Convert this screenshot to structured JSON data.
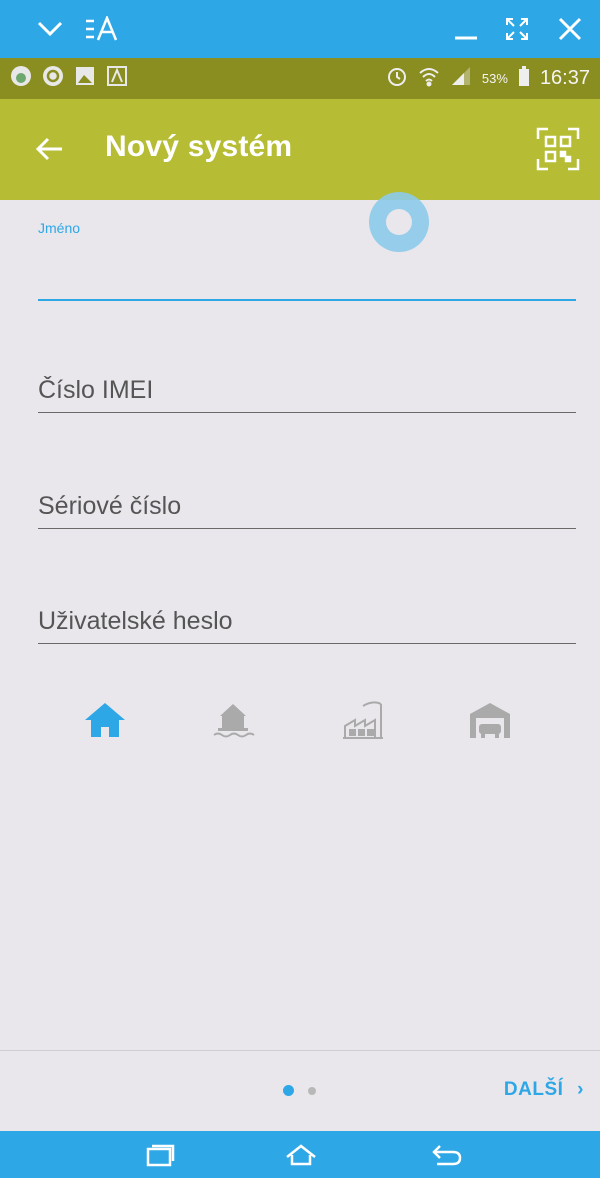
{
  "appbar": {
    "title": "Nový systém"
  },
  "statusbar": {
    "battery": "53%",
    "time": "16:37"
  },
  "form": {
    "name_label": "Jméno",
    "imei_placeholder": "Číslo IMEI",
    "serial_placeholder": "Sériové číslo",
    "password_placeholder": "Uživatelské heslo"
  },
  "types": [
    {
      "name": "home-icon",
      "selected": true
    },
    {
      "name": "lake-house-icon",
      "selected": false
    },
    {
      "name": "factory-icon",
      "selected": false
    },
    {
      "name": "garage-icon",
      "selected": false
    }
  ],
  "footer": {
    "next_label": "DALŠÍ",
    "next_chevron": "›",
    "page_count": 2,
    "current_page": 1
  },
  "colors": {
    "accent": "#2ea7e6",
    "appbar": "#b6bd34",
    "statusbar": "#8a8d1f",
    "background": "#e9e7ec"
  }
}
